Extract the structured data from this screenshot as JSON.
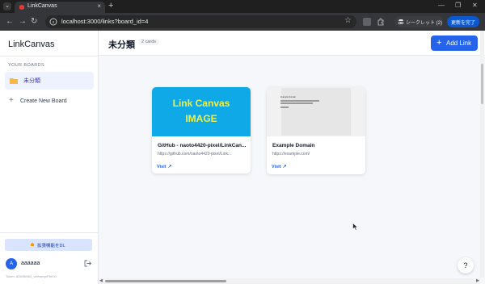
{
  "browser": {
    "tab_title": "LinkCanvas",
    "tab_close": "×",
    "new_tab": "+",
    "url": "localhost:3000/links?board_id=4",
    "incognito_label": "シークレット (2)",
    "update_label": "更新を完了",
    "icons": {
      "back": "back-arrow-icon",
      "forward": "forward-arrow-icon",
      "reload": "reload-icon",
      "star": "star-icon"
    }
  },
  "sidebar": {
    "logo": "LinkCanvas",
    "section_label": "YOUR BOARDS",
    "boards": [
      {
        "label": "未分類",
        "active": true
      }
    ],
    "create_board": "Create New Board",
    "extension_button": "拡張機能をDL",
    "user": {
      "avatar_initial": "A",
      "name": "aaaaaa",
      "session": "Token: ADMIN962_cvHweqnP8rXG"
    }
  },
  "main": {
    "board_title": "未分類",
    "card_count": "2 cards",
    "add_link_label": "Add Link",
    "cards": [
      {
        "thumbnail_text_line1": "Link Canvas",
        "thumbnail_text_line2": "IMAGE",
        "title": "GitHub - naoto4420-pixel/LinkCan...",
        "url": "https://github.com/naoto4420-pixel/Link...",
        "visit_label": "Visit"
      },
      {
        "preview_title": "Example Domain",
        "title": "Example Domain",
        "url": "https://example.com/",
        "visit_label": "Visit"
      }
    ],
    "help_label": "?"
  },
  "colors": {
    "accent": "#2563eb",
    "active_board_bg": "#eef2ff",
    "thumbnail_bg": "#0fa9e8",
    "thumbnail_text": "#eef04a"
  }
}
